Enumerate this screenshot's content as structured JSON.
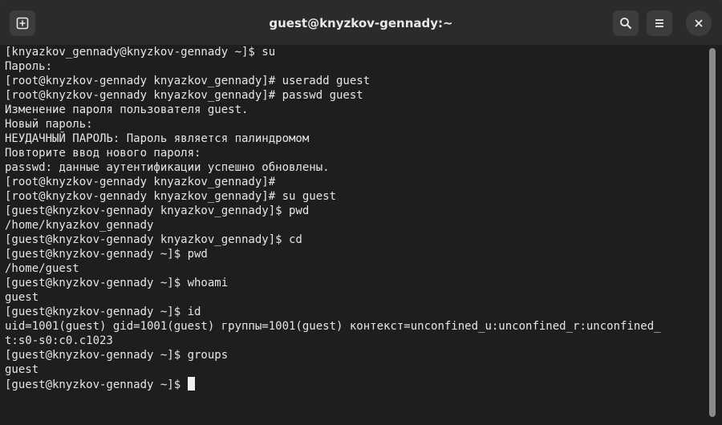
{
  "window": {
    "title": "guest@knyzkov-gennady:~"
  },
  "header": {
    "new_tab_icon": "new-tab-icon",
    "search_icon": "search-icon",
    "menu_icon": "hamburger-menu-icon",
    "close_icon": "close-icon"
  },
  "terminal": {
    "lines": [
      "[knyazkov_gennady@knyzkov-gennady ~]$ su",
      "Пароль:",
      "[root@knyzkov-gennady knyazkov_gennady]# useradd guest",
      "[root@knyzkov-gennady knyazkov_gennady]# passwd guest",
      "Изменение пароля пользователя guest.",
      "Новый пароль:",
      "НЕУДАЧНЫЙ ПАРОЛЬ: Пароль является палиндромом",
      "Повторите ввод нового пароля:",
      "passwd: данные аутентификации успешно обновлены.",
      "[root@knyzkov-gennady knyazkov_gennady]#",
      "[root@knyzkov-gennady knyazkov_gennady]# su guest",
      "[guest@knyzkov-gennady knyazkov_gennady]$ pwd",
      "/home/knyazkov_gennady",
      "[guest@knyzkov-gennady knyazkov_gennady]$ cd",
      "[guest@knyzkov-gennady ~]$ pwd",
      "/home/guest",
      "[guest@knyzkov-gennady ~]$ whoami",
      "guest",
      "[guest@knyzkov-gennady ~]$ id",
      "uid=1001(guest) gid=1001(guest) группы=1001(guest) контекст=unconfined_u:unconfined_r:unconfined_",
      "t:s0-s0:c0.c1023",
      "[guest@knyzkov-gennady ~]$ groups",
      "guest"
    ],
    "prompt": "[guest@knyzkov-gennady ~]$ "
  },
  "colors": {
    "background": "#1e1e1e",
    "titlebar": "#2b2b2b",
    "text": "#e6e6e6"
  }
}
